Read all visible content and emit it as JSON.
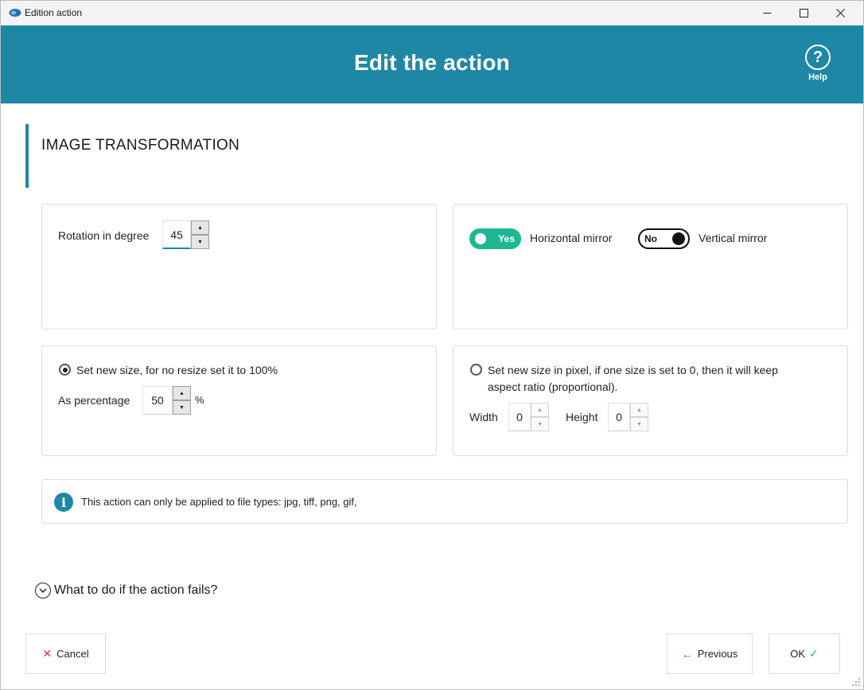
{
  "window": {
    "title": "Edition action"
  },
  "header": {
    "title": "Edit the action",
    "help_label": "Help",
    "help_glyph": "?"
  },
  "section": {
    "title": "IMAGE TRANSFORMATION"
  },
  "rotation": {
    "label": "Rotation in degree",
    "value": "45"
  },
  "mirror": {
    "horizontal": {
      "state": "Yes",
      "label": "Horizontal mirror"
    },
    "vertical": {
      "state": "No",
      "label": "Vertical mirror"
    }
  },
  "resize_percent": {
    "radio_label": "Set new size, for no resize set it to 100%",
    "selected": true,
    "field_label": "As percentage",
    "value": "50",
    "unit": "%"
  },
  "resize_pixel": {
    "radio_label_line1": "Set new size in pixel, if one size is set to 0, then it will keep",
    "radio_label_line2": "aspect ratio (proportional).",
    "selected": false,
    "width_label": "Width",
    "width_value": "0",
    "height_label": "Height",
    "height_value": "0"
  },
  "info": {
    "text": "This action can only be applied to file types: jpg, tiff, png, gif,"
  },
  "failure": {
    "label": "What to do if the action fails?"
  },
  "buttons": {
    "cancel": "Cancel",
    "previous": "Previous",
    "ok": "OK"
  },
  "colors": {
    "accent": "#1f87a6",
    "toggle_on": "#1db88f",
    "cancel_x": "#e0322f",
    "ok_check": "#1db88f"
  }
}
